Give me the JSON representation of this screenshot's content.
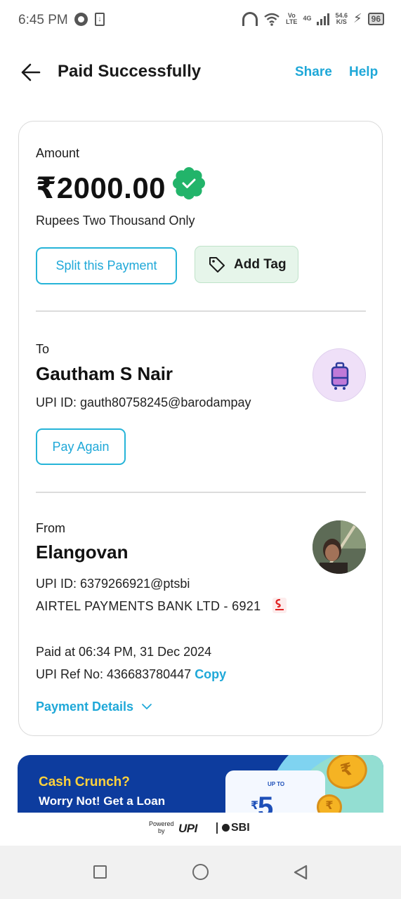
{
  "status_bar": {
    "time": "6:45 PM",
    "volte_top": "Vo",
    "volte_bottom": "LTE",
    "network": "4G",
    "speed_value": "54.6",
    "speed_unit": "K/S",
    "battery": "96",
    "icons": [
      "whatsapp-icon",
      "download-icon",
      "headset-icon",
      "wifi-icon",
      "signal-icon",
      "charging-icon",
      "battery-icon"
    ]
  },
  "header": {
    "title": "Paid Successfully",
    "share": "Share",
    "help": "Help"
  },
  "amount": {
    "label": "Amount",
    "value": "₹2000.00",
    "words": "Rupees Two Thousand Only"
  },
  "actions": {
    "split": "Split this Payment",
    "add_tag": "Add Tag"
  },
  "to": {
    "label": "To",
    "name": "Gautham S Nair",
    "upi": "UPI ID: gauth80758245@barodampay",
    "pay_again": "Pay Again"
  },
  "from": {
    "label": "From",
    "name": "Elangovan",
    "upi": "UPI ID: 6379266921@ptsbi",
    "bank": "AIRTEL PAYMENTS BANK LTD - 6921"
  },
  "transaction": {
    "paid_at": "Paid at 06:34 PM, 31 Dec 2024",
    "ref_label": "UPI Ref No: 436683780447",
    "copy": "Copy",
    "details": "Payment Details"
  },
  "banner": {
    "title": "Cash Crunch?",
    "subtitle": "Worry Not! Get a Loan",
    "upto": "UP TO",
    "amount": "5",
    "rupee": "₹"
  },
  "footer": {
    "powered_line1": "Powered",
    "powered_line2": "by",
    "upi": "UPI",
    "partner": "SBI"
  },
  "colors": {
    "accent": "#1fa8d8",
    "success": "#22b46a",
    "tag_bg": "#e6f5ea",
    "banner_bg": "#0d3c9e",
    "banner_title": "#ffd23c"
  }
}
